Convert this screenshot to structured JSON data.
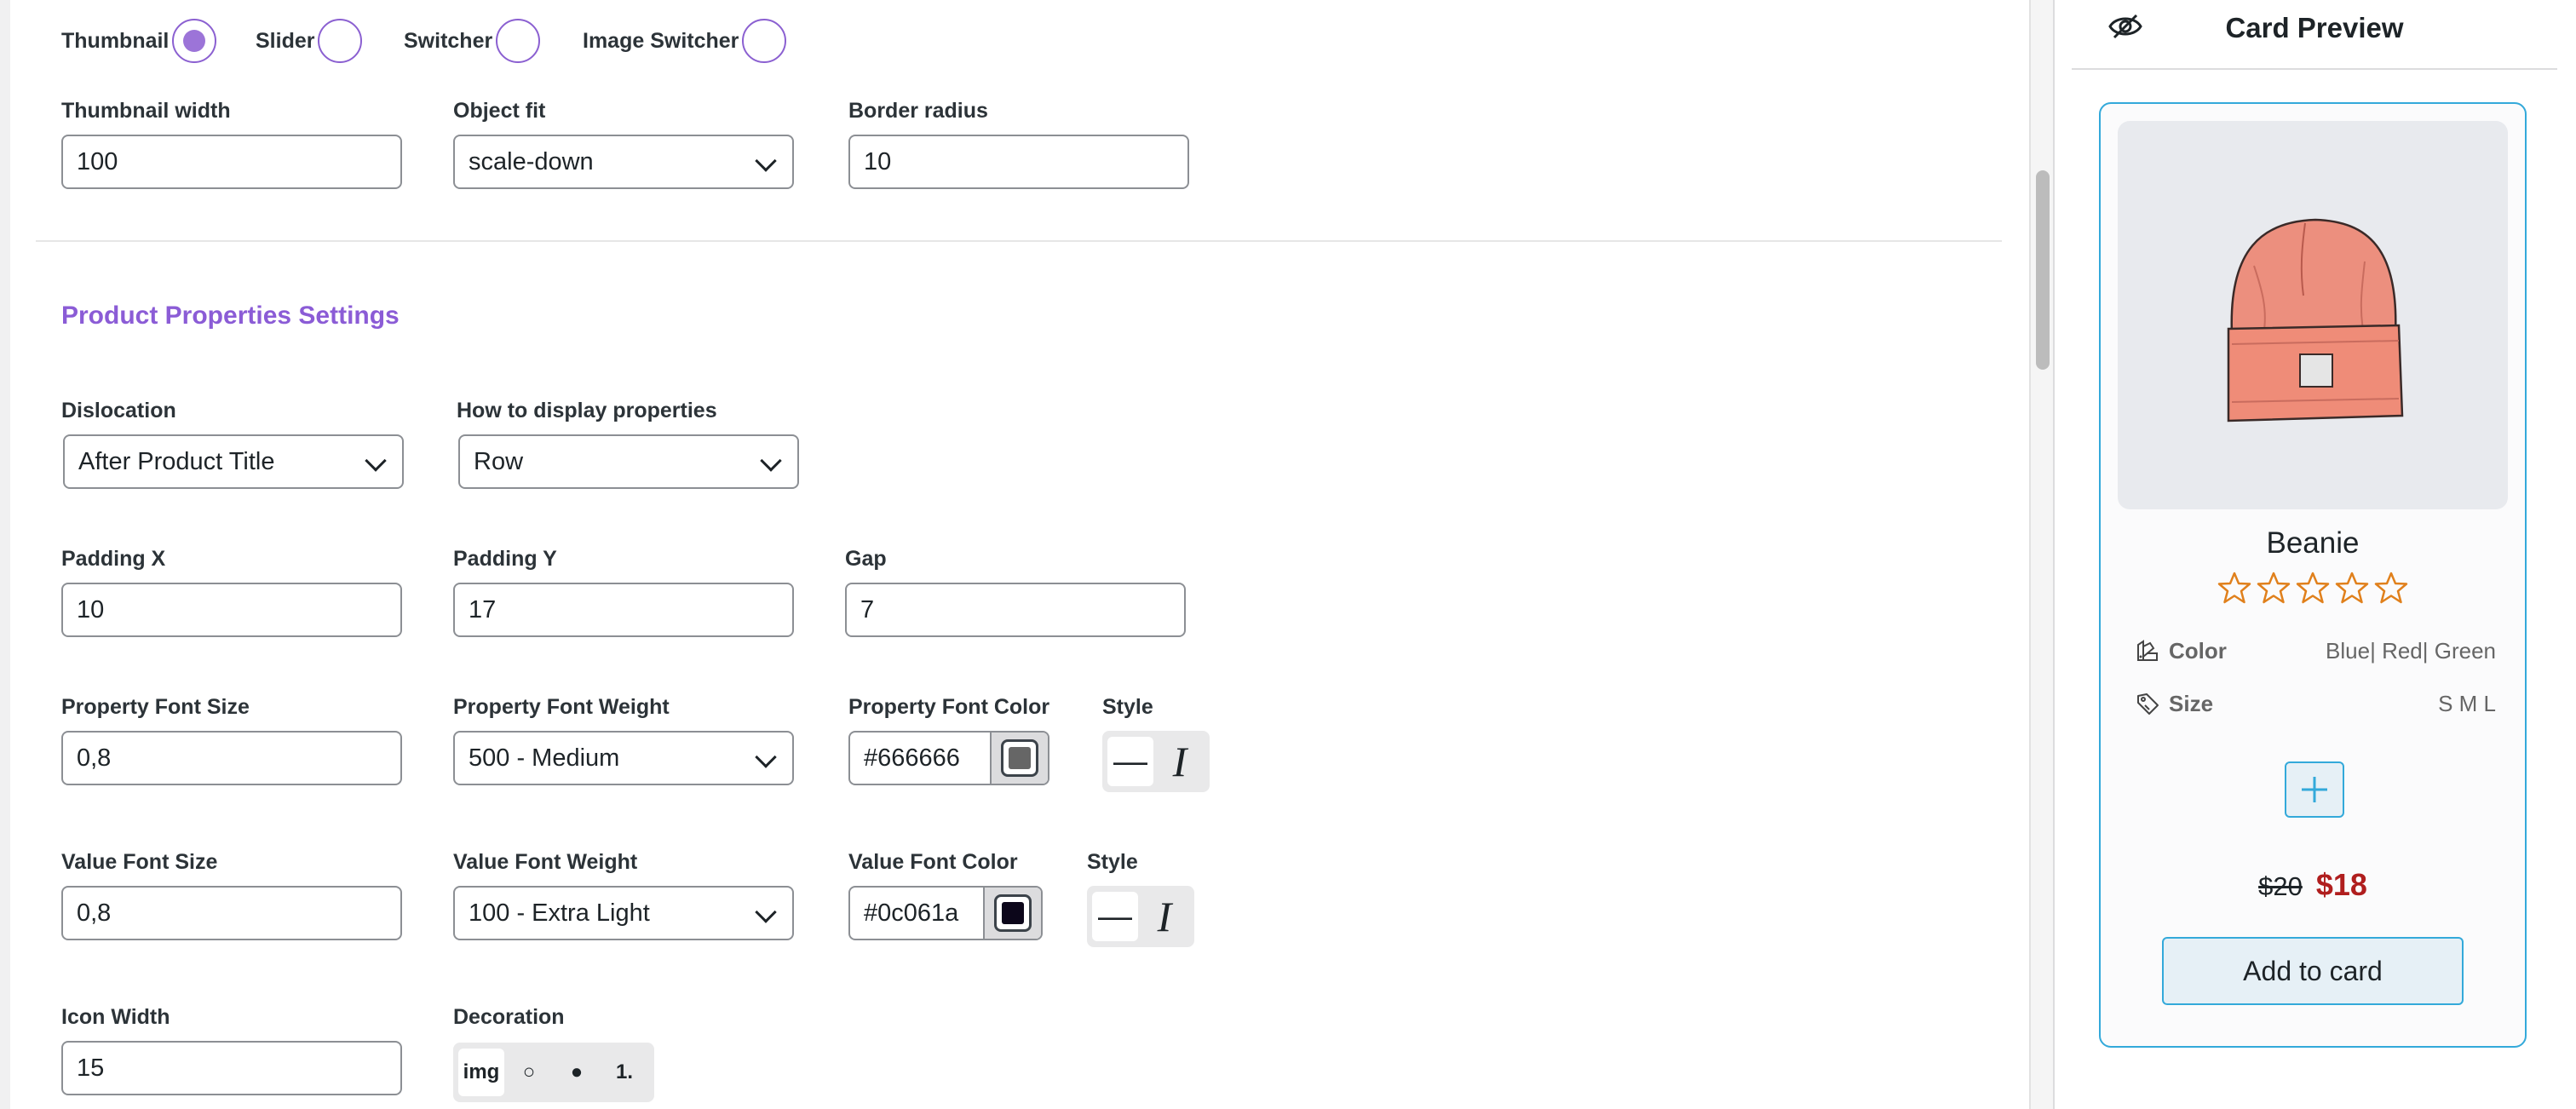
{
  "modes": [
    {
      "label": "Thumbnail",
      "checked": true
    },
    {
      "label": "Slider",
      "checked": false
    },
    {
      "label": "Switcher",
      "checked": false
    },
    {
      "label": "Image Switcher",
      "checked": false
    }
  ],
  "thumbnail": {
    "width_label": "Thumbnail width",
    "width_value": "100",
    "object_fit_label": "Object fit",
    "object_fit_value": "scale-down",
    "border_radius_label": "Border radius",
    "border_radius_value": "10"
  },
  "section_title": "Product Properties Settings",
  "props": {
    "dislocation_label": "Dislocation",
    "dislocation_value": "After Product Title",
    "display_label": "How to display properties",
    "display_value": "Row",
    "padding_x_label": "Padding X",
    "padding_x_value": "10",
    "padding_y_label": "Padding Y",
    "padding_y_value": "17",
    "gap_label": "Gap",
    "gap_value": "7",
    "prop_font_size_label": "Property Font Size",
    "prop_font_size_value": "0,8",
    "prop_font_weight_label": "Property Font Weight",
    "prop_font_weight_value": "500 - Medium",
    "prop_font_color_label": "Property Font Color",
    "prop_font_color_value": "#666666",
    "prop_style_label": "Style",
    "value_font_size_label": "Value Font Size",
    "value_font_size_value": "0,8",
    "value_font_weight_label": "Value Font Weight",
    "value_font_weight_value": "100 - Extra Light",
    "value_font_color_label": "Value Font Color",
    "value_font_color_value": "#0c061a",
    "value_style_label": "Style",
    "icon_width_label": "Icon Width",
    "icon_width_value": "15",
    "decoration_label": "Decoration",
    "decoration_options": [
      "img",
      "○",
      "●",
      "1."
    ]
  },
  "style_icons": [
    "strikethrough-icon",
    "italic-icon"
  ],
  "style_glyphs": {
    "strike": "—",
    "italic": "I"
  },
  "preview": {
    "title": "Card Preview",
    "product_name": "Beanie",
    "rating": 0,
    "rating_max": 5,
    "properties": [
      {
        "name": "Color",
        "value": "Blue| Red| Green",
        "icon": "palette-icon"
      },
      {
        "name": "Size",
        "value": "S M L",
        "icon": "tag-icon"
      }
    ],
    "old_price": "$20",
    "new_price": "$18",
    "add_button": "Add to card"
  },
  "colors": {
    "accent": "#8b5cd6",
    "preview_border": "#33a9da",
    "star": "#e0801c",
    "sale_price": "#b01e1e"
  }
}
